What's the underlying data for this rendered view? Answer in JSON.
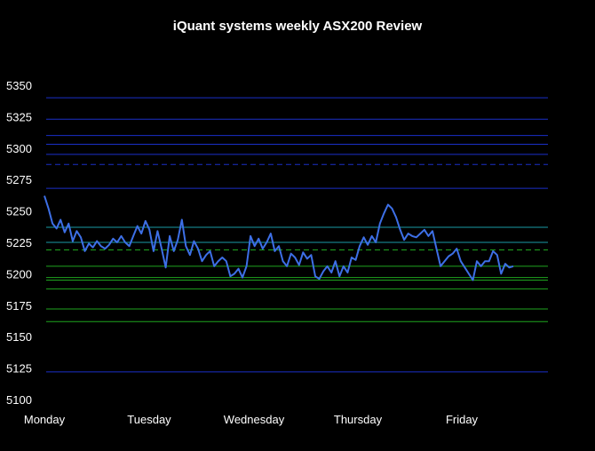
{
  "chart_data": {
    "type": "line",
    "title": "iQuant systems weekly ASX200 Review",
    "xlabel": "",
    "ylabel": "",
    "ylim": [
      5100,
      5350
    ],
    "yticks": [
      5100,
      5125,
      5150,
      5175,
      5200,
      5225,
      5250,
      5275,
      5300,
      5325,
      5350
    ],
    "xticks": [
      "Monday",
      "Tuesday",
      "Wednesday",
      "Thursday",
      "Friday"
    ],
    "grid": false,
    "legend": "none",
    "colors": {
      "background": "#000000",
      "series": "#3d6fe6",
      "level_blue": "#1a2fc8",
      "level_cyan": "#1a9aa6",
      "level_green": "#1fa51f",
      "text": "#ffffff"
    },
    "reference_lines": [
      {
        "value": 5340,
        "color": "blue",
        "style": "solid"
      },
      {
        "value": 5323,
        "color": "blue",
        "style": "solid"
      },
      {
        "value": 5310,
        "color": "blue",
        "style": "solid"
      },
      {
        "value": 5303,
        "color": "blue",
        "style": "solid"
      },
      {
        "value": 5295,
        "color": "blue",
        "style": "solid"
      },
      {
        "value": 5287,
        "color": "blue",
        "style": "dashed"
      },
      {
        "value": 5268,
        "color": "blue",
        "style": "solid"
      },
      {
        "value": 5237,
        "color": "cyan",
        "style": "solid"
      },
      {
        "value": 5225,
        "color": "cyan",
        "style": "solid"
      },
      {
        "value": 5219,
        "color": "green",
        "style": "dashed"
      },
      {
        "value": 5206,
        "color": "green",
        "style": "solid"
      },
      {
        "value": 5197,
        "color": "green",
        "style": "solid"
      },
      {
        "value": 5195,
        "color": "green",
        "style": "solid"
      },
      {
        "value": 5188,
        "color": "green",
        "style": "solid"
      },
      {
        "value": 5172,
        "color": "green",
        "style": "solid"
      },
      {
        "value": 5162,
        "color": "green",
        "style": "solid"
      },
      {
        "value": 5122,
        "color": "blue",
        "style": "solid"
      }
    ],
    "series": [
      {
        "values": [
          5262,
          5252,
          5240,
          5236,
          5243,
          5233,
          5240,
          5226,
          5234,
          5229,
          5218,
          5224,
          5221,
          5226,
          5222,
          5220,
          5223,
          5228,
          5225,
          5230,
          5225,
          5222,
          5230,
          5238,
          5232,
          5242,
          5235,
          5218,
          5234,
          5220,
          5205,
          5230,
          5218,
          5227,
          5243,
          5222,
          5215,
          5226,
          5220,
          5210,
          5215,
          5218,
          5206,
          5210,
          5213,
          5210,
          5198,
          5200,
          5204,
          5197,
          5206,
          5230,
          5222,
          5228,
          5220,
          5225,
          5232,
          5218,
          5222,
          5210,
          5206,
          5216,
          5213,
          5207,
          5217,
          5212,
          5215,
          5198,
          5196,
          5202,
          5206,
          5201,
          5210,
          5198,
          5206,
          5201,
          5213,
          5211,
          5222,
          5229,
          5223,
          5230,
          5225,
          5240,
          5248,
          5255,
          5252,
          5245,
          5235,
          5227,
          5232,
          5230,
          5229,
          5232,
          5235,
          5230,
          5234,
          5220,
          5206,
          5210,
          5214,
          5216,
          5220,
          5210,
          5205,
          5200,
          5195,
          5210,
          5206,
          5210,
          5210,
          5218,
          5215,
          5200,
          5208,
          5205,
          5206
        ]
      }
    ]
  }
}
